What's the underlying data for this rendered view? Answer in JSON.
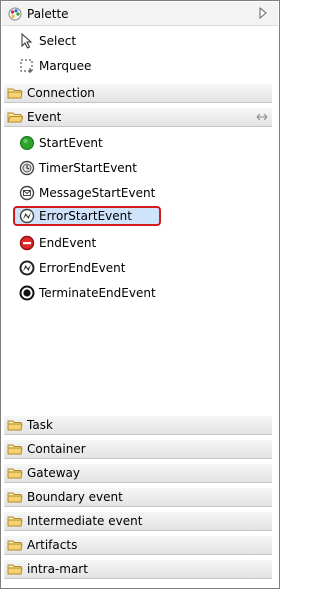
{
  "palette": {
    "title": "Palette",
    "tools": [
      {
        "label": "Select",
        "icon": "arrow-cursor-icon"
      },
      {
        "label": "Marquee",
        "icon": "marquee-icon"
      }
    ]
  },
  "drawers": {
    "connection": "Connection",
    "event": {
      "label": "Event",
      "entries": [
        {
          "label": "StartEvent",
          "icon": "start-event-icon"
        },
        {
          "label": "TimerStartEvent",
          "icon": "timer-start-event-icon"
        },
        {
          "label": "MessageStartEvent",
          "icon": "message-start-event-icon"
        },
        {
          "label": "ErrorStartEvent",
          "icon": "error-start-event-icon",
          "selected": true
        },
        {
          "label": "EndEvent",
          "icon": "end-event-icon"
        },
        {
          "label": "ErrorEndEvent",
          "icon": "error-end-event-icon"
        },
        {
          "label": "TerminateEndEvent",
          "icon": "terminate-end-event-icon"
        }
      ]
    },
    "task": "Task",
    "container": "Container",
    "gateway": "Gateway",
    "boundary_event": "Boundary event",
    "intermediate_event": "Intermediate event",
    "artifacts": "Artifacts",
    "intra_mart": "intra-mart"
  },
  "colors": {
    "selection_fill": "#cfe3fb",
    "highlight_border": "#d21b1b",
    "start_event_green": "#2aa52a",
    "end_event_red": "#e02a2a"
  }
}
